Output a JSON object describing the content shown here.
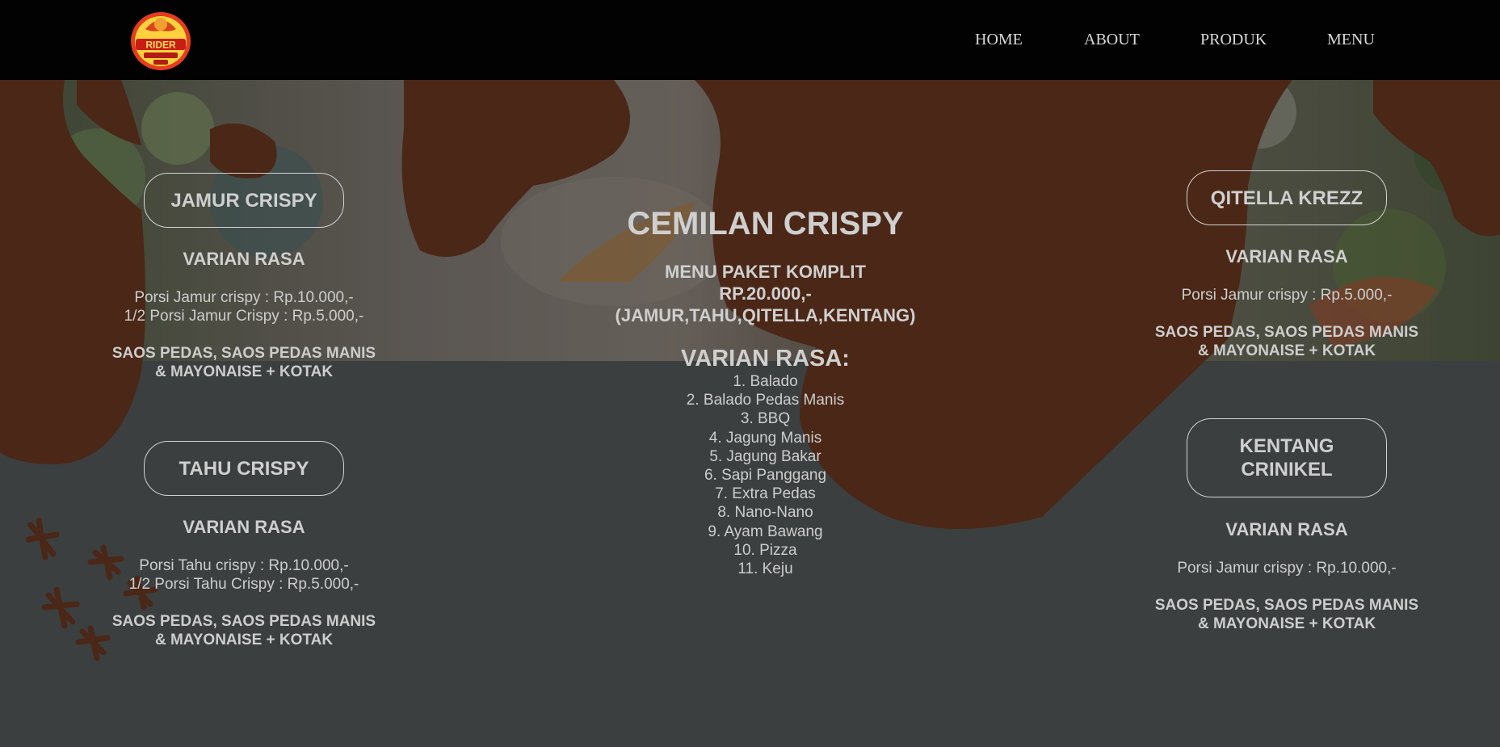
{
  "nav": {
    "logo_alt": "RIDER logo",
    "links": [
      "HOME",
      "ABOUT",
      "PRODUK",
      "MENU"
    ]
  },
  "center": {
    "title": "CEMILAN CRISPY",
    "package_line1": "MENU PAKET KOMPLIT",
    "package_line2": "RP.20.000,-",
    "package_line3": "(JAMUR,TAHU,QITELLA,KENTANG)",
    "flavor_heading": "VARIAN RASA:",
    "flavors": [
      "1. Balado",
      "2. Balado Pedas Manis",
      "3. BBQ",
      "4. Jagung Manis",
      "5. Jagung Bakar",
      "6. Sapi Panggang",
      "7. Extra Pedas",
      "8. Nano-Nano",
      "9. Ayam Bawang",
      "10. Pizza",
      "11. Keju"
    ]
  },
  "products": [
    {
      "name": "JAMUR CRISPY",
      "varian": "VARIAN RASA",
      "price1": "Porsi Jamur crispy : Rp.10.000,-",
      "price2": "1/2 Porsi Jamur Crispy : Rp.5.000,-",
      "sauce1": "SAOS PEDAS, SAOS PEDAS MANIS",
      "sauce2": "& MAYONAISE + KOTAK"
    },
    {
      "name": "TAHU CRISPY",
      "varian": "VARIAN RASA",
      "price1": "Porsi Tahu crispy : Rp.10.000,-",
      "price2": "1/2 Porsi Tahu Crispy : Rp.5.000,-",
      "sauce1": "SAOS PEDAS, SAOS PEDAS MANIS",
      "sauce2": "& MAYONAISE + KOTAK"
    },
    {
      "name": "QITELLA KREZZ",
      "varian": "VARIAN RASA",
      "price1": "Porsi Jamur crispy : Rp.5.000,-",
      "sauce1": "SAOS PEDAS, SAOS PEDAS MANIS",
      "sauce2": "& MAYONAISE + KOTAK"
    },
    {
      "name_line1": "KENTANG",
      "name_line2": "CRINIKEL",
      "varian": "VARIAN RASA",
      "price1": "Porsi Jamur crispy : Rp.10.000,-",
      "sauce1": "SAOS PEDAS, SAOS PEDAS MANIS",
      "sauce2": "& MAYONAISE + KOTAK"
    }
  ],
  "colors": {
    "navbar": "#020202",
    "background": "#3c3f3f",
    "brown_shape": "#4a2716",
    "text": "#cfcfcf"
  }
}
